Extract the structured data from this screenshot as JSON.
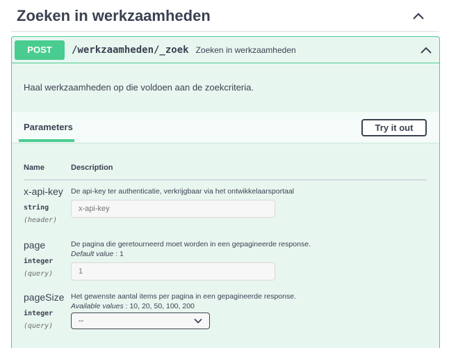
{
  "section": {
    "title": "Zoeken in werkzaamheden"
  },
  "operation": {
    "method": "POST",
    "path": "/werkzaamheden/_zoek",
    "summary": "Zoeken in werkzaamheden",
    "description": "Haal werkzaamheden op die voldoen aan de zoekcriteria."
  },
  "tabs": {
    "parameters": "Parameters",
    "try_button": "Try it out"
  },
  "table": {
    "col_name": "Name",
    "col_description": "Description"
  },
  "params": [
    {
      "name": "x-api-key",
      "type": "string",
      "in": "(header)",
      "description": "De api-key ter authenticatie, verkrijgbaar via het ontwikkelaarsportaal",
      "placeholder": "x-api-key"
    },
    {
      "name": "page",
      "type": "integer",
      "in": "(query)",
      "description": "De pagina die geretourneerd moet worden in een gepagineerde response.",
      "extra_label": "Default value",
      "extra_value": " : 1",
      "placeholder": "1"
    },
    {
      "name": "pageSize",
      "type": "integer",
      "in": "(query)",
      "description": "Het gewenste aantal items per pagina in een gepagineerde response.",
      "extra_label": "Available values",
      "extra_value": " : 10, 20, 50, 100, 200",
      "selected": "--"
    }
  ],
  "icons": {
    "collapse": "chevron-up-icon",
    "select": "chevron-down-icon"
  },
  "colors": {
    "post": "#49cc90",
    "post_bg": "#e8f6f0",
    "text": "#3b4151"
  }
}
